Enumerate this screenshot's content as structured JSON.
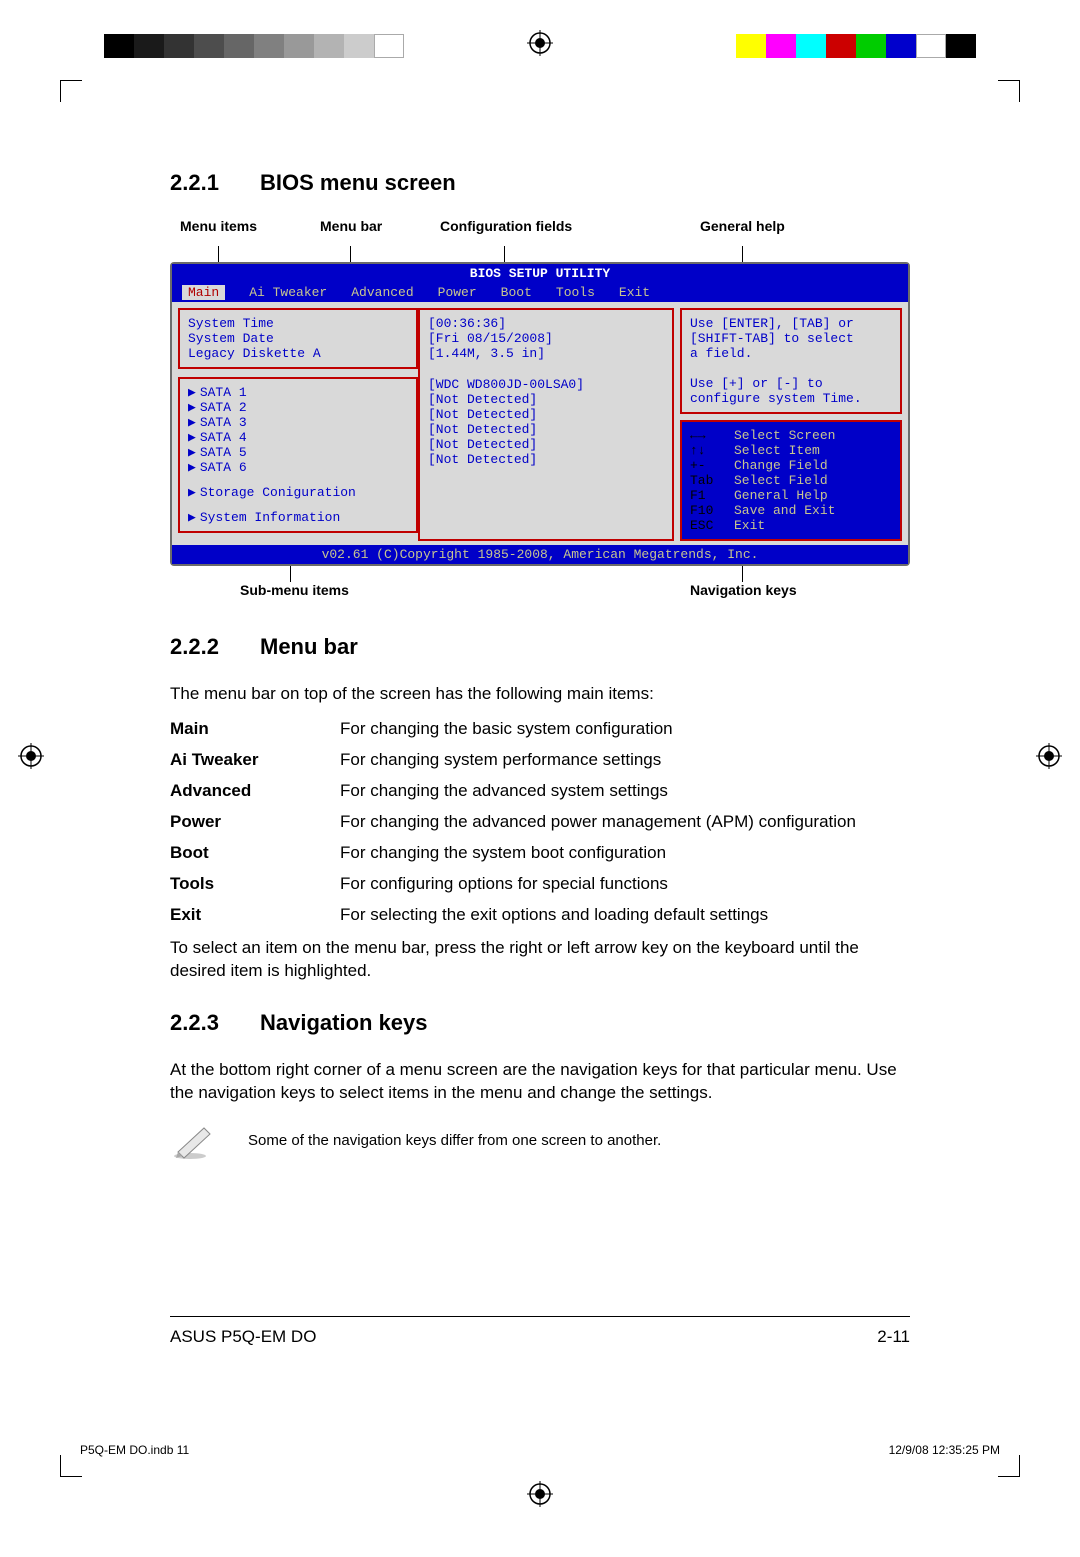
{
  "section_221": {
    "num": "2.2.1",
    "title": "BIOS menu screen"
  },
  "top_labels": {
    "menu_items": "Menu items",
    "menu_bar": "Menu bar",
    "config_fields": "Configuration fields",
    "general_help": "General help"
  },
  "bottom_labels": {
    "submenu": "Sub-menu items",
    "navkeys": "Navigation keys"
  },
  "bios": {
    "title": "BIOS SETUP UTILITY",
    "menu": [
      "Main",
      "Ai Tweaker",
      "Advanced",
      "Power",
      "Boot",
      "Tools",
      "Exit"
    ],
    "menu_selected": "Main",
    "fields_top": [
      {
        "label": "System Time",
        "value": "[00:36:36]"
      },
      {
        "label": "System Date",
        "value": "[Fri 08/15/2008]"
      },
      {
        "label": "Legacy Diskette A",
        "value": "[1.44M, 3.5 in]"
      }
    ],
    "sata": [
      {
        "label": "SATA 1",
        "value": "[WDC WD800JD-00LSA0]"
      },
      {
        "label": "SATA 2",
        "value": "[Not Detected]"
      },
      {
        "label": "SATA 3",
        "value": "[Not Detected]"
      },
      {
        "label": "SATA 4",
        "value": "[Not Detected]"
      },
      {
        "label": "SATA 5",
        "value": "[Not Detected]"
      },
      {
        "label": "SATA 6",
        "value": "[Not Detected]"
      }
    ],
    "extra": [
      "Storage Coniguration",
      "System Information"
    ],
    "help_lines": [
      "Use [ENTER], [TAB] or",
      "[SHIFT-TAB] to select",
      "a field.",
      "",
      "Use [+] or [-] to",
      "configure system Time."
    ],
    "nav": [
      {
        "k": "←→",
        "v": "Select Screen"
      },
      {
        "k": "↑↓",
        "v": "Select Item"
      },
      {
        "k": "+-",
        "v": "Change Field"
      },
      {
        "k": "Tab",
        "v": "Select Field"
      },
      {
        "k": "F1",
        "v": "General Help"
      },
      {
        "k": "F10",
        "v": "Save and Exit"
      },
      {
        "k": "ESC",
        "v": "Exit"
      }
    ],
    "footer": "v02.61 (C)Copyright 1985-2008, American Megatrends, Inc."
  },
  "section_222": {
    "num": "2.2.2",
    "title": "Menu bar",
    "intro": "The menu bar on top of the screen has the following main items:",
    "items": [
      {
        "name": "Main",
        "desc": "For changing the basic system configuration"
      },
      {
        "name": "Ai Tweaker",
        "desc": "For changing system performance settings"
      },
      {
        "name": "Advanced",
        "desc": "For changing the advanced system settings"
      },
      {
        "name": "Power",
        "desc": "For changing the advanced power management (APM) configuration"
      },
      {
        "name": "Boot",
        "desc": "For changing the system boot configuration"
      },
      {
        "name": "Tools",
        "desc": "For configuring options for special functions"
      },
      {
        "name": "Exit",
        "desc": "For selecting the exit options and loading default settings"
      }
    ],
    "outro": "To select an item on the menu bar, press the right or left arrow key on the keyboard until the desired item is highlighted."
  },
  "section_223": {
    "num": "2.2.3",
    "title": "Navigation keys",
    "text": "At the bottom right corner of a menu screen are the navigation keys for that particular menu. Use the navigation keys to select items in the menu and change the settings.",
    "note": "Some of the navigation keys differ from one screen to another."
  },
  "footer": {
    "left": "ASUS P5Q-EM DO",
    "right": "2-11"
  },
  "imposition": {
    "left": "P5Q-EM DO.indb   11",
    "right": "12/9/08   12:35:25 PM"
  },
  "strip_gray": [
    "#000000",
    "#1a1a1a",
    "#333333",
    "#4d4d4d",
    "#666666",
    "#808080",
    "#999999",
    "#b3b3b3",
    "#cccccc",
    "#ffffff"
  ],
  "strip_color": [
    "#ffff00",
    "#ff00ff",
    "#00ffff",
    "#cc0000",
    "#00cc00",
    "#0000cc",
    "#ffffff",
    "#000000"
  ]
}
